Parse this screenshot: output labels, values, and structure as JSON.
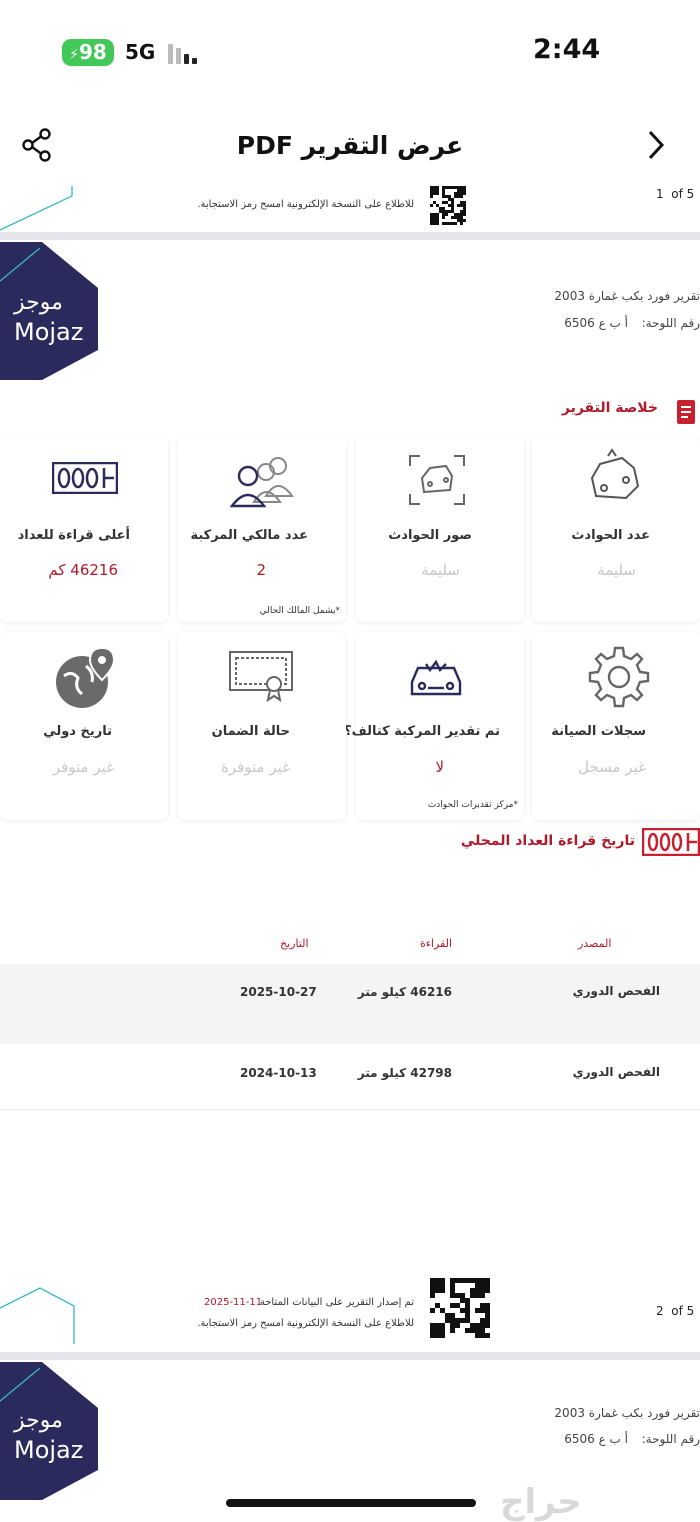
{
  "status_bar": {
    "battery": "98",
    "network": "5G",
    "time": "2:44"
  },
  "nav": {
    "title": "عرض التقرير PDF"
  },
  "page1_footer": {
    "qr_text": "للاطلاع على النسخة الإلكترونية امسح رمز الاستجابة.",
    "page_label": "1  of 5"
  },
  "header": {
    "brand_ar": "موجز",
    "brand_en": "Mojaz",
    "report_title": "تقرير فورد بكب غمارة 2003",
    "plate_label": "رقم اللوحة:",
    "plate_value": "أ ب ع 6506"
  },
  "summary": {
    "section_title": "خلاصة التقرير",
    "cards": [
      {
        "title": "عدد الحوادث",
        "value": "سليمة",
        "note": ""
      },
      {
        "title": "صور الحوادث",
        "value": "سليمة",
        "note": ""
      },
      {
        "title": "عدد مالكي المركبة",
        "value": "2",
        "note": "*يشمل المالك الحالي"
      },
      {
        "title": "أعلى قراءة للعداد",
        "value": "46216 كم",
        "note": ""
      },
      {
        "title": "سجلات الصيانة",
        "value": "غير مسجل",
        "note": ""
      },
      {
        "title": "تم تقدير المركبة كتالف؟",
        "value": "لا",
        "note": "*مركز تقديرات الحوادث"
      },
      {
        "title": "حالة الضمان",
        "value": "غير متوفرة",
        "note": ""
      },
      {
        "title": "تاريخ دولي",
        "value": "غير متوفر",
        "note": ""
      }
    ]
  },
  "odometer": {
    "section_title": "تاريخ قراءة العداد المحلي",
    "icon_digits": "000",
    "columns": [
      "المصدر",
      "القراءة",
      "التاريخ"
    ],
    "rows": [
      {
        "source": "الفحص الدوري",
        "reading": "46216 كيلو متر",
        "date": "2025-10-27"
      },
      {
        "source": "الفحص الدوري",
        "reading": "42798 كيلو متر",
        "date": "2024-10-13"
      }
    ]
  },
  "page2_footer": {
    "issued_text": "تم إصدار التقرير على البيانات المتاحة",
    "issued_date": "2025-11-11",
    "qr_text": "للاطلاع على النسخة الإلكترونية امسح رمز الاستجابة.",
    "page_label": "2  of 5"
  },
  "page3_header": {
    "brand_ar": "موجز",
    "brand_en": "Mojaz",
    "report_title": "تقرير فورد بكب غمارة 2003",
    "plate_label": "رقم اللوحة:",
    "plate_value": "أ ب ع 6506"
  },
  "watermark": "حراج",
  "colors": {
    "accent": "#b01a2a",
    "brand": "#2b2a5c",
    "battery": "#43c85a",
    "teal": "#39b8c8"
  }
}
